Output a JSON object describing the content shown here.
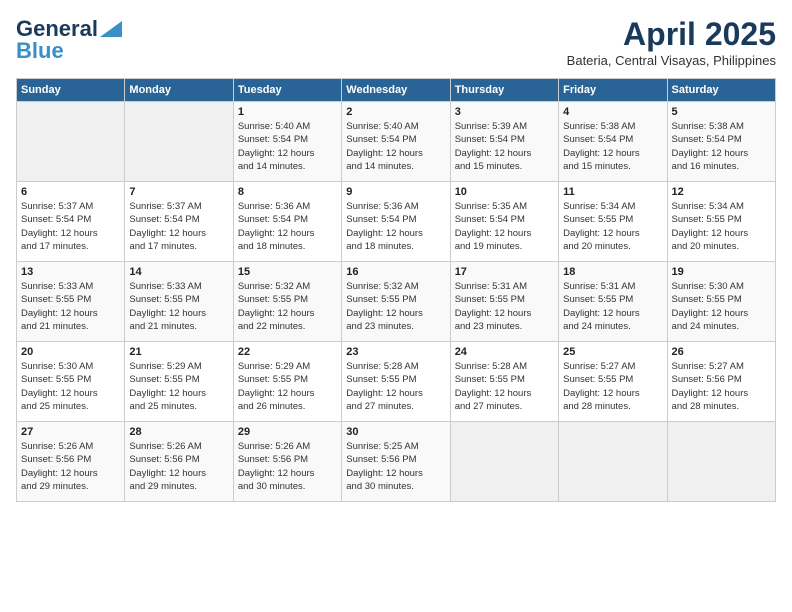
{
  "header": {
    "logo_line1": "General",
    "logo_line2": "Blue",
    "month_year": "April 2025",
    "location": "Bateria, Central Visayas, Philippines"
  },
  "days_of_week": [
    "Sunday",
    "Monday",
    "Tuesday",
    "Wednesday",
    "Thursday",
    "Friday",
    "Saturday"
  ],
  "weeks": [
    [
      {
        "day": "",
        "info": ""
      },
      {
        "day": "",
        "info": ""
      },
      {
        "day": "1",
        "info": "Sunrise: 5:40 AM\nSunset: 5:54 PM\nDaylight: 12 hours\nand 14 minutes."
      },
      {
        "day": "2",
        "info": "Sunrise: 5:40 AM\nSunset: 5:54 PM\nDaylight: 12 hours\nand 14 minutes."
      },
      {
        "day": "3",
        "info": "Sunrise: 5:39 AM\nSunset: 5:54 PM\nDaylight: 12 hours\nand 15 minutes."
      },
      {
        "day": "4",
        "info": "Sunrise: 5:38 AM\nSunset: 5:54 PM\nDaylight: 12 hours\nand 15 minutes."
      },
      {
        "day": "5",
        "info": "Sunrise: 5:38 AM\nSunset: 5:54 PM\nDaylight: 12 hours\nand 16 minutes."
      }
    ],
    [
      {
        "day": "6",
        "info": "Sunrise: 5:37 AM\nSunset: 5:54 PM\nDaylight: 12 hours\nand 17 minutes."
      },
      {
        "day": "7",
        "info": "Sunrise: 5:37 AM\nSunset: 5:54 PM\nDaylight: 12 hours\nand 17 minutes."
      },
      {
        "day": "8",
        "info": "Sunrise: 5:36 AM\nSunset: 5:54 PM\nDaylight: 12 hours\nand 18 minutes."
      },
      {
        "day": "9",
        "info": "Sunrise: 5:36 AM\nSunset: 5:54 PM\nDaylight: 12 hours\nand 18 minutes."
      },
      {
        "day": "10",
        "info": "Sunrise: 5:35 AM\nSunset: 5:54 PM\nDaylight: 12 hours\nand 19 minutes."
      },
      {
        "day": "11",
        "info": "Sunrise: 5:34 AM\nSunset: 5:55 PM\nDaylight: 12 hours\nand 20 minutes."
      },
      {
        "day": "12",
        "info": "Sunrise: 5:34 AM\nSunset: 5:55 PM\nDaylight: 12 hours\nand 20 minutes."
      }
    ],
    [
      {
        "day": "13",
        "info": "Sunrise: 5:33 AM\nSunset: 5:55 PM\nDaylight: 12 hours\nand 21 minutes."
      },
      {
        "day": "14",
        "info": "Sunrise: 5:33 AM\nSunset: 5:55 PM\nDaylight: 12 hours\nand 21 minutes."
      },
      {
        "day": "15",
        "info": "Sunrise: 5:32 AM\nSunset: 5:55 PM\nDaylight: 12 hours\nand 22 minutes."
      },
      {
        "day": "16",
        "info": "Sunrise: 5:32 AM\nSunset: 5:55 PM\nDaylight: 12 hours\nand 23 minutes."
      },
      {
        "day": "17",
        "info": "Sunrise: 5:31 AM\nSunset: 5:55 PM\nDaylight: 12 hours\nand 23 minutes."
      },
      {
        "day": "18",
        "info": "Sunrise: 5:31 AM\nSunset: 5:55 PM\nDaylight: 12 hours\nand 24 minutes."
      },
      {
        "day": "19",
        "info": "Sunrise: 5:30 AM\nSunset: 5:55 PM\nDaylight: 12 hours\nand 24 minutes."
      }
    ],
    [
      {
        "day": "20",
        "info": "Sunrise: 5:30 AM\nSunset: 5:55 PM\nDaylight: 12 hours\nand 25 minutes."
      },
      {
        "day": "21",
        "info": "Sunrise: 5:29 AM\nSunset: 5:55 PM\nDaylight: 12 hours\nand 25 minutes."
      },
      {
        "day": "22",
        "info": "Sunrise: 5:29 AM\nSunset: 5:55 PM\nDaylight: 12 hours\nand 26 minutes."
      },
      {
        "day": "23",
        "info": "Sunrise: 5:28 AM\nSunset: 5:55 PM\nDaylight: 12 hours\nand 27 minutes."
      },
      {
        "day": "24",
        "info": "Sunrise: 5:28 AM\nSunset: 5:55 PM\nDaylight: 12 hours\nand 27 minutes."
      },
      {
        "day": "25",
        "info": "Sunrise: 5:27 AM\nSunset: 5:55 PM\nDaylight: 12 hours\nand 28 minutes."
      },
      {
        "day": "26",
        "info": "Sunrise: 5:27 AM\nSunset: 5:56 PM\nDaylight: 12 hours\nand 28 minutes."
      }
    ],
    [
      {
        "day": "27",
        "info": "Sunrise: 5:26 AM\nSunset: 5:56 PM\nDaylight: 12 hours\nand 29 minutes."
      },
      {
        "day": "28",
        "info": "Sunrise: 5:26 AM\nSunset: 5:56 PM\nDaylight: 12 hours\nand 29 minutes."
      },
      {
        "day": "29",
        "info": "Sunrise: 5:26 AM\nSunset: 5:56 PM\nDaylight: 12 hours\nand 30 minutes."
      },
      {
        "day": "30",
        "info": "Sunrise: 5:25 AM\nSunset: 5:56 PM\nDaylight: 12 hours\nand 30 minutes."
      },
      {
        "day": "",
        "info": ""
      },
      {
        "day": "",
        "info": ""
      },
      {
        "day": "",
        "info": ""
      }
    ]
  ]
}
